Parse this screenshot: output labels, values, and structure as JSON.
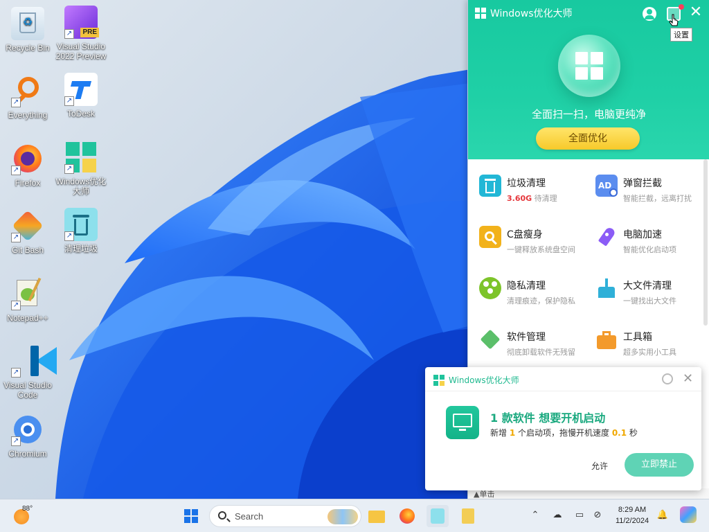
{
  "desktop": {
    "icons": [
      {
        "label": "Recycle Bin",
        "icon": "recycle-bin-icon"
      },
      {
        "label": "Visual Studio 2022 Preview",
        "icon": "visual-studio-preview-icon",
        "badge": "PRE"
      },
      {
        "label": "Everything",
        "icon": "everything-search-icon"
      },
      {
        "label": "ToDesk",
        "icon": "todesk-icon"
      },
      {
        "label": "Firefox",
        "icon": "firefox-icon"
      },
      {
        "label": "Windows优化大师",
        "icon": "windows-optimizer-icon"
      },
      {
        "label": "Git Bash",
        "icon": "git-bash-icon"
      },
      {
        "label": "清理垃圾",
        "icon": "trash-cleaner-icon"
      },
      {
        "label": "Notepad++",
        "icon": "notepadpp-icon"
      },
      {
        "label": "Visual Studio Code",
        "icon": "vscode-icon"
      },
      {
        "label": "Chromium",
        "icon": "chromium-icon"
      }
    ]
  },
  "optimizer": {
    "title": "Windows优化大师",
    "tooltip": "设置",
    "slogan": "全面扫一扫，电脑更纯净",
    "primary_button": "全面优化",
    "accent_color": "#1fd0a6",
    "features": [
      {
        "title": "垃圾清理",
        "highlight": "3.60G",
        "desc": " 待清理",
        "icon": "trash-bin-icon",
        "color": "#22b7d6"
      },
      {
        "title": "弹窗拦截",
        "desc": "智能拦截，远离打扰",
        "icon": "ad-block-icon",
        "color": "#5b8def"
      },
      {
        "title": "C盘瘦身",
        "desc": "一键释放系统盘空间",
        "icon": "disk-slim-icon",
        "color": "#f2b21b"
      },
      {
        "title": "电脑加速",
        "desc": "智能优化启动项",
        "icon": "rocket-icon",
        "color": "#8b5cf6"
      },
      {
        "title": "隐私清理",
        "desc": "清理痕迹，保护隐私",
        "icon": "privacy-icon",
        "color": "#7dc42a"
      },
      {
        "title": "大文件清理",
        "desc": "一键找出大文件",
        "icon": "broom-icon",
        "color": "#2fb0d8"
      },
      {
        "title": "软件管理",
        "desc": "彻底卸载软件无残留",
        "icon": "software-box-icon",
        "color": "#5bbf6a"
      },
      {
        "title": "工具箱",
        "desc": "超多实用小工具",
        "icon": "toolbox-icon",
        "color": "#f39a2b"
      }
    ],
    "bottom_label": "▲单击"
  },
  "notification": {
    "app_title": "Windows优化大师",
    "headline": "1 款软件 想要开机启动",
    "detail_prefix": "新增 ",
    "detail_count": "1",
    "detail_mid": " 个启动项，拖慢开机速度 ",
    "detail_seconds": "0.1",
    "detail_suffix": " 秒",
    "allow_label": "允许",
    "block_label": "立即禁止"
  },
  "taskbar": {
    "temperature": "88°",
    "search_placeholder": "Search",
    "time": "8:29 AM",
    "date": "11/2/2024"
  }
}
